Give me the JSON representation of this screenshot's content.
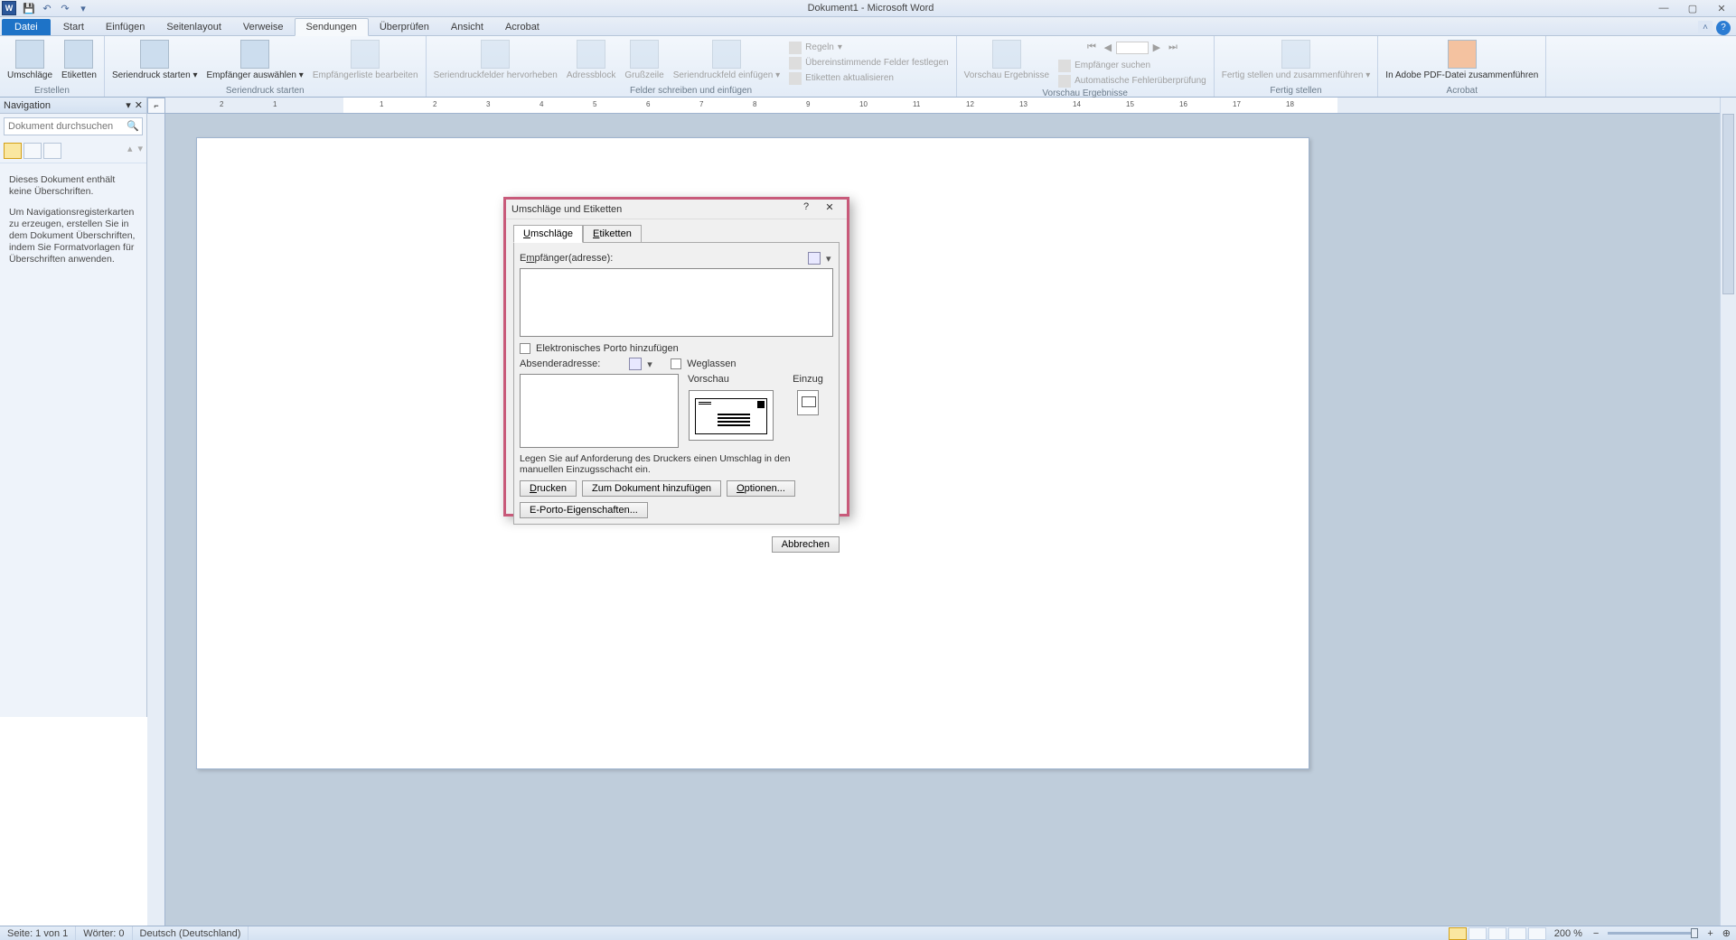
{
  "app": {
    "title": "Dokument1 - Microsoft Word"
  },
  "tabs": {
    "file": "Datei",
    "start": "Start",
    "einfuegen": "Einfügen",
    "seitenlayout": "Seitenlayout",
    "verweise": "Verweise",
    "sendungen": "Sendungen",
    "ueberpruefen": "Überprüfen",
    "ansicht": "Ansicht",
    "acrobat": "Acrobat"
  },
  "ribbon": {
    "erstellen": {
      "label": "Erstellen",
      "umschlaege": "Umschläge",
      "etiketten": "Etiketten"
    },
    "seriendruck_starten": {
      "label": "Seriendruck starten",
      "seriendruck": "Seriendruck starten",
      "empfaenger": "Empfänger auswählen",
      "liste": "Empfängerliste bearbeiten"
    },
    "felder": {
      "label": "Felder schreiben und einfügen",
      "seriendruckfelder": "Seriendruckfelder hervorheben",
      "adressblock": "Adressblock",
      "grussszeile": "Grußzeile",
      "seriendruckfeld": "Seriendruckfeld einfügen",
      "regeln": "Regeln",
      "uebereinstimmende": "Übereinstimmende Felder festlegen",
      "aktualisieren": "Etiketten aktualisieren"
    },
    "vorschau": {
      "label": "Vorschau Ergebnisse",
      "vorschaubtn": "Vorschau Ergebnisse",
      "suchen": "Empfänger suchen",
      "fehler": "Automatische Fehlerüberprüfung"
    },
    "fertig": {
      "label": "Fertig stellen",
      "btn": "Fertig stellen und zusammenführen"
    },
    "acrobat": {
      "label": "Acrobat",
      "btn": "In Adobe PDF-Datei zusammenführen"
    }
  },
  "nav": {
    "title": "Navigation",
    "search_placeholder": "Dokument durchsuchen",
    "msg1": "Dieses Dokument enthält keine Überschriften.",
    "msg2": "Um Navigationsregisterkarten zu erzeugen, erstellen Sie in dem Dokument Überschriften, indem Sie Formatvorlagen für Überschriften anwenden."
  },
  "dialog": {
    "title": "Umschläge und Etiketten",
    "tab_umschlaege": "mschläge",
    "tab_umschlaege_ul": "U",
    "tab_etiketten": "tiketten",
    "tab_etiketten_ul": "E",
    "empfaenger": "Empfänger(adresse):",
    "empfaenger_ul": "m",
    "empfaenger_value": "",
    "eporto_cb": "Elektronisches Porto hinzufügen",
    "absender": "bsenderadresse:",
    "absender_ul": "A",
    "absender_value": "",
    "weglassen": "eglassen",
    "weglassen_ul": "W",
    "vorschau": "Vorschau",
    "einzug": "Einzug",
    "hint": "Legen Sie auf Anforderung des Druckers einen Umschlag in den manuellen Einzugsschacht ein.",
    "btn_drucken": "rucken",
    "btn_drucken_ul": "D",
    "btn_hinzufuegen": "Zum Dokument hinzufügen",
    "btn_optionen": "ptionen...",
    "btn_optionen_ul": "O",
    "btn_eporto": "E-Porto-Eigenschaften...",
    "btn_eporto_ul": "g",
    "btn_abbrechen": "Abbrechen"
  },
  "status": {
    "seite": "Seite: 1 von 1",
    "woerter": "Wörter: 0",
    "sprache": "Deutsch (Deutschland)",
    "zoom": "200 %"
  },
  "ruler_ticks": [
    "2",
    "1",
    "",
    "1",
    "2",
    "3",
    "4",
    "5",
    "6",
    "7",
    "8",
    "9",
    "10",
    "11",
    "12",
    "13",
    "14",
    "15",
    "16",
    "17",
    "18"
  ]
}
